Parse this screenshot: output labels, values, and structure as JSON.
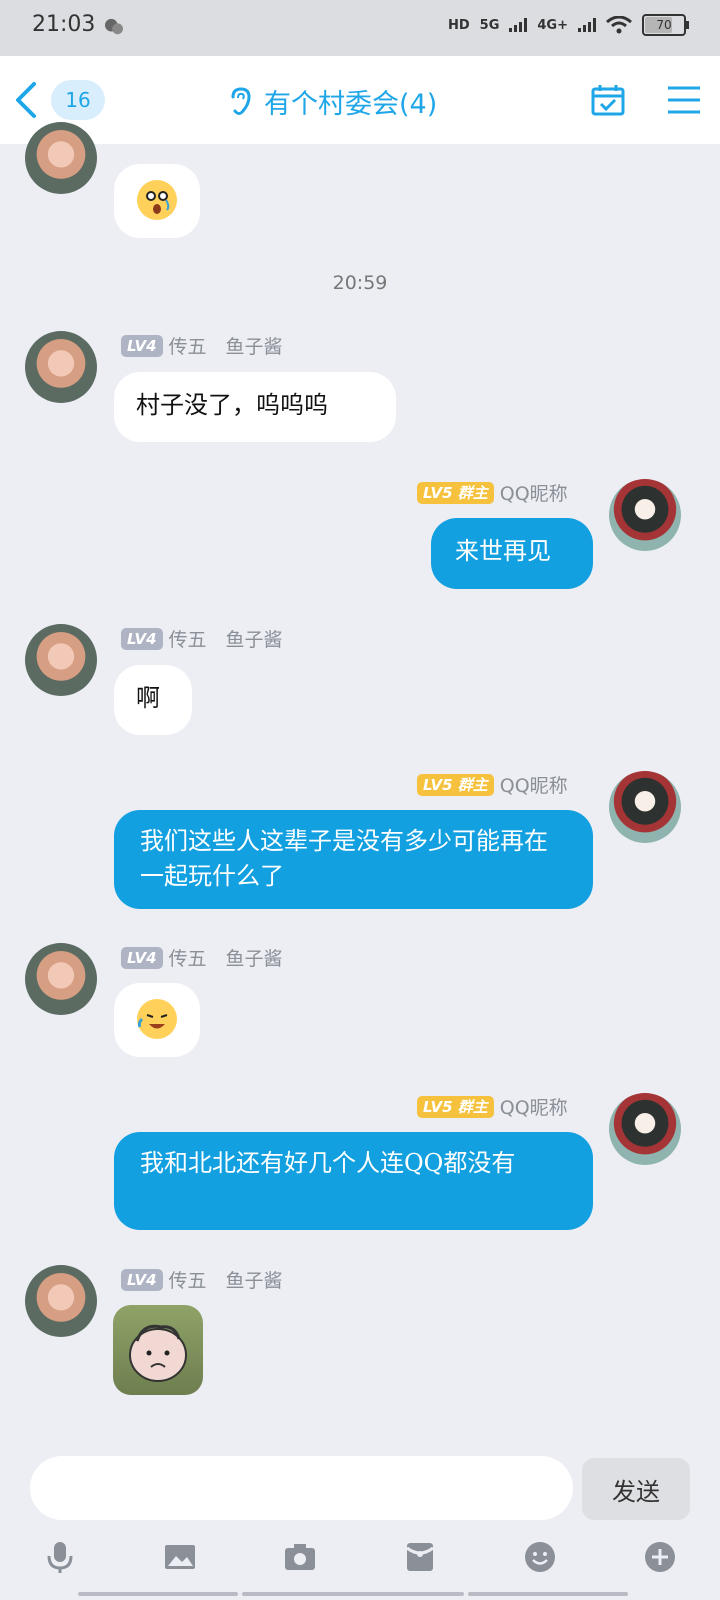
{
  "status": {
    "time": "21:03",
    "hd": "HD",
    "net1": "5G",
    "net2": "4G+",
    "battery": "70"
  },
  "header": {
    "back_count": "16",
    "title": "有个村委会(4)"
  },
  "messages": [
    {
      "nick_level": "LV4",
      "nick_name": "传五　鱼子酱",
      "text": "村子没了，呜呜呜"
    },
    {
      "nick_level": "LV5 群主",
      "nick_name": "QQ昵称",
      "text": "来世再见"
    },
    {
      "nick_level": "LV4",
      "nick_name": "传五　鱼子酱",
      "text": "啊"
    },
    {
      "nick_level": "LV5 群主",
      "nick_name": "QQ昵称",
      "text": "我们这些人这辈子是没有多少可能再在一起玩什么了"
    },
    {
      "nick_level": "LV4",
      "nick_name": "传五　鱼子酱"
    },
    {
      "nick_level": "LV5 群主",
      "nick_name": "QQ昵称",
      "text": "我和北北还有好几个人连QQ都没有"
    },
    {
      "nick_level": "LV4",
      "nick_name": "传五　鱼子酱"
    }
  ],
  "timestamp": "20:59",
  "input": {
    "placeholder": "",
    "send_label": "发送"
  },
  "icons": [
    "microphone-icon",
    "image-icon",
    "camera-icon",
    "red-packet-icon",
    "emoji-icon",
    "plus-icon"
  ]
}
